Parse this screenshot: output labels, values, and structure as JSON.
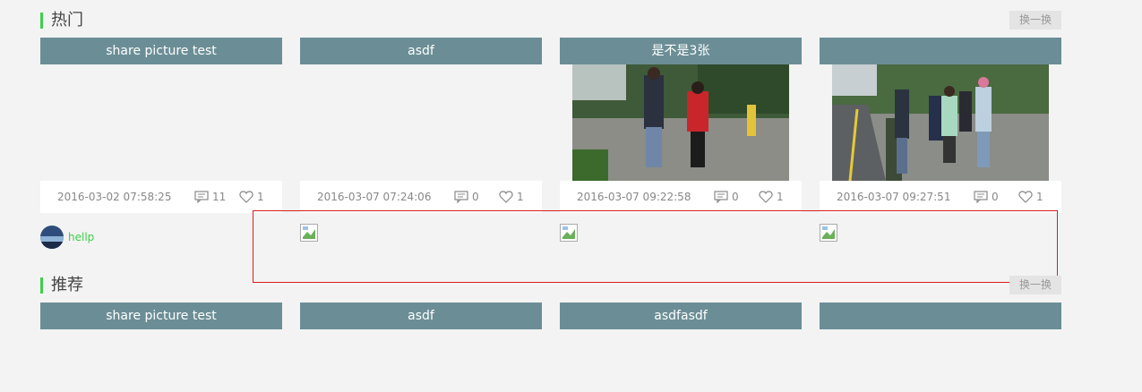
{
  "hot": {
    "title": "热门",
    "refresh_label": "换一换",
    "cards": [
      {
        "title": "share picture test",
        "date": "2016-03-02 07:58:25",
        "comments": "11",
        "likes": "1"
      },
      {
        "title": "asdf",
        "date": "2016-03-07 07:24:06",
        "comments": "0",
        "likes": "1"
      },
      {
        "title": "是不是3张",
        "date": "2016-03-07 09:22:58",
        "comments": "0",
        "likes": "1"
      },
      {
        "title": "",
        "date": "2016-03-07 09:27:51",
        "comments": "0",
        "likes": "1"
      }
    ],
    "user": {
      "name": "hellp"
    }
  },
  "recommend": {
    "title": "推荐",
    "refresh_label": "换一换",
    "cards": [
      {
        "title": "share picture test"
      },
      {
        "title": "asdf"
      },
      {
        "title": "asdfasdf"
      },
      {
        "title": ""
      }
    ]
  },
  "colors": {
    "accent": "#3ecf4a",
    "card_title_bg": "#6b8e96",
    "highlight_border": "#d81e1e"
  }
}
